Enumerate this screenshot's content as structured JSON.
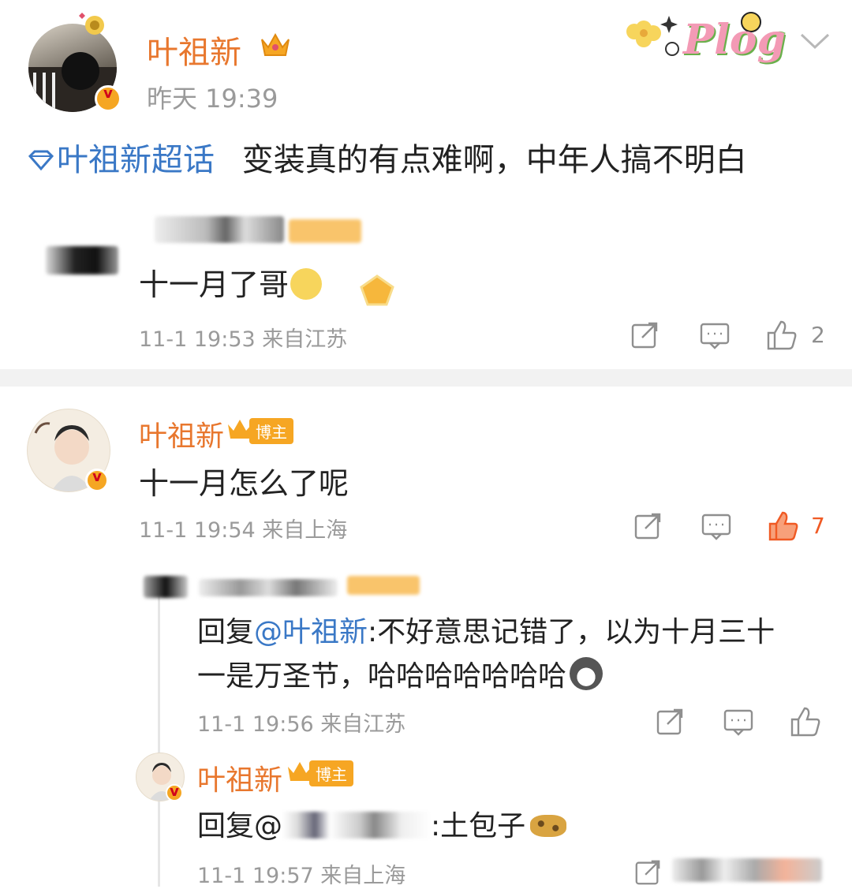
{
  "post": {
    "author": "叶祖新",
    "time": "昨天 19:39",
    "topic": "叶祖新超话",
    "text": "变装真的有点难啊，中年人搞不明白",
    "sticker_text": "Plog"
  },
  "comment1": {
    "text": "十一月了哥",
    "meta": "11-1 19:53 来自江苏",
    "likes": "2"
  },
  "comment2": {
    "author": "叶祖新",
    "badge": "博主",
    "text": "十一月怎么了呢",
    "meta": "11-1 19:54 来自上海",
    "likes": "7"
  },
  "reply1": {
    "prefix": "回复",
    "mention": "@叶祖新",
    "text_line1": ":不好意思记错了，以为十月三十",
    "text_line2": "一是万圣节，哈哈哈哈哈哈哈",
    "meta": "11-1 19:56 来自江苏"
  },
  "reply2": {
    "author": "叶祖新",
    "badge": "博主",
    "prefix": "回复@",
    "text": ":土包子",
    "meta": "11-1 19:57 来自上海"
  },
  "icons": [
    "share-icon",
    "comment-icon",
    "like-icon",
    "chevron-down-icon",
    "crown-icon"
  ],
  "colors": {
    "name": "#e8772e",
    "link": "#3a78c6",
    "like_active": "#f05a24",
    "meta": "#9a9a9a"
  }
}
